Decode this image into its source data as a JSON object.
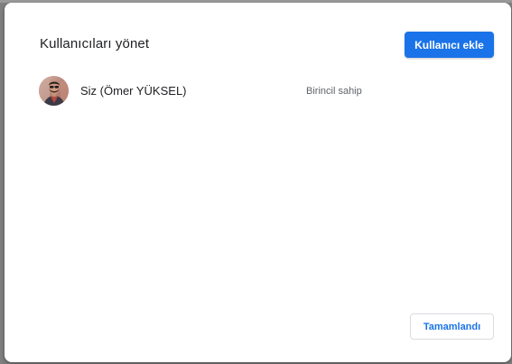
{
  "dialog": {
    "title": "Kullanıcıları yönet",
    "add_user_label": "Kullanıcı ekle",
    "done_label": "Tamamlandı"
  },
  "users": [
    {
      "name": "Siz (Ömer YÜKSEL)",
      "role": "Birincil sahip",
      "avatar": "profile-photo"
    }
  ],
  "colors": {
    "accent": "#1a73e8",
    "title_text": "#202124",
    "secondary_text": "#5f6368",
    "backdrop": "#808080"
  }
}
